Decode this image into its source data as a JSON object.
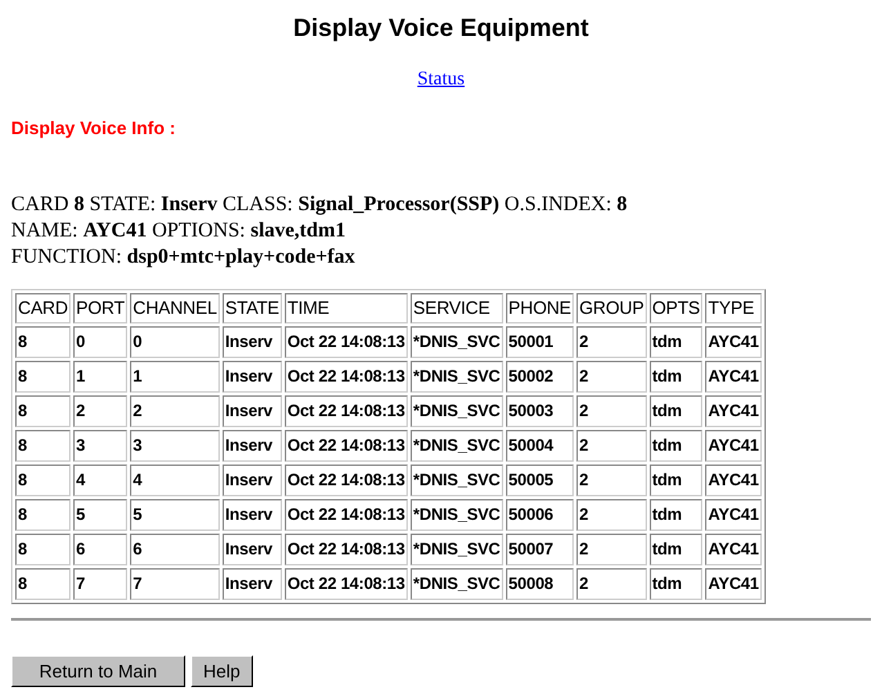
{
  "title": "Display Voice Equipment",
  "link": "Status",
  "section_label": "Display Voice Info :",
  "info_lines": [
    "CARD **8** STATE: **Inserv** CLASS: **Signal_Processor(SSP)** O.S.INDEX: **8**",
    "NAME: **AYC41** OPTIONS: **slave,tdm1**",
    "FUNCTION: **dsp0+mtc+play+code+fax**"
  ],
  "table": {
    "columns": [
      "CARD",
      "PORT",
      "CHANNEL",
      "STATE",
      "TIME",
      "SERVICE",
      "PHONE",
      "GROUP",
      "OPTS",
      "TYPE"
    ],
    "rows": [
      [
        "8",
        "0",
        "0",
        "Inserv",
        "Oct 22 14:08:13",
        "*DNIS_SVC",
        "50001",
        "2",
        "tdm",
        "AYC41"
      ],
      [
        "8",
        "1",
        "1",
        "Inserv",
        "Oct 22 14:08:13",
        "*DNIS_SVC",
        "50002",
        "2",
        "tdm",
        "AYC41"
      ],
      [
        "8",
        "2",
        "2",
        "Inserv",
        "Oct 22 14:08:13",
        "*DNIS_SVC",
        "50003",
        "2",
        "tdm",
        "AYC41"
      ],
      [
        "8",
        "3",
        "3",
        "Inserv",
        "Oct 22 14:08:13",
        "*DNIS_SVC",
        "50004",
        "2",
        "tdm",
        "AYC41"
      ],
      [
        "8",
        "4",
        "4",
        "Inserv",
        "Oct 22 14:08:13",
        "*DNIS_SVC",
        "50005",
        "2",
        "tdm",
        "AYC41"
      ],
      [
        "8",
        "5",
        "5",
        "Inserv",
        "Oct 22 14:08:13",
        "*DNIS_SVC",
        "50006",
        "2",
        "tdm",
        "AYC41"
      ],
      [
        "8",
        "6",
        "6",
        "Inserv",
        "Oct 22 14:08:13",
        "*DNIS_SVC",
        "50007",
        "2",
        "tdm",
        "AYC41"
      ],
      [
        "8",
        "7",
        "7",
        "Inserv",
        "Oct 22 14:08:13",
        "*DNIS_SVC",
        "50008",
        "2",
        "tdm",
        "AYC41"
      ]
    ]
  },
  "buttons": [
    "Return to Main",
    "Help"
  ]
}
